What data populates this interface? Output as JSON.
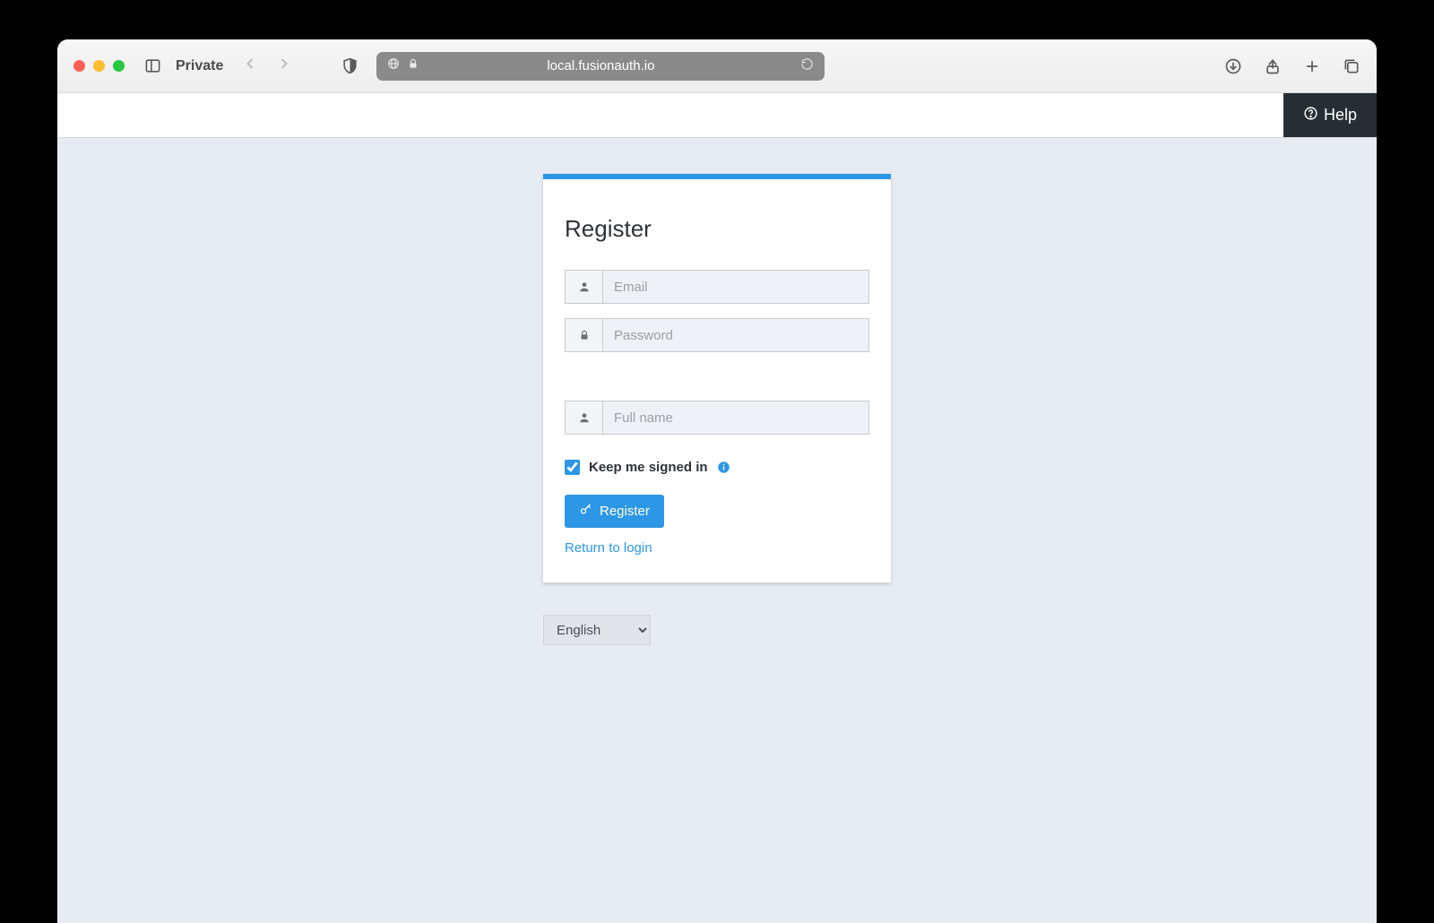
{
  "browser": {
    "private_label": "Private",
    "url": "local.fusionauth.io"
  },
  "topbar": {
    "help_label": "Help"
  },
  "register": {
    "title": "Register",
    "email_placeholder": "Email",
    "password_placeholder": "Password",
    "fullname_placeholder": "Full name",
    "keep_signed_in_label": "Keep me signed in",
    "register_button": "Register",
    "return_link": "Return to login"
  },
  "language": {
    "selected": "English"
  }
}
